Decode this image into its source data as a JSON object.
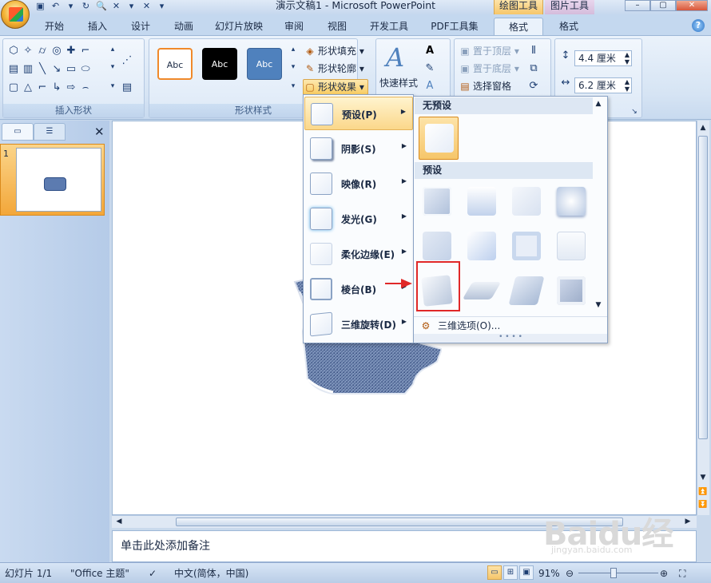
{
  "app": {
    "doc_title": "演示文稿1 - Microsoft PowerPoint",
    "context_tabs": [
      "绘图工具",
      "图片工具"
    ]
  },
  "tabs": [
    "开始",
    "插入",
    "设计",
    "动画",
    "幻灯片放映",
    "审阅",
    "视图",
    "开发工具",
    "PDF工具集",
    "格式",
    "格式"
  ],
  "ribbon": {
    "groups": {
      "insert_shapes": "插入形状",
      "shape_styles": "形状样式"
    },
    "style_swatches": [
      "Abc",
      "Abc",
      "Abc"
    ],
    "shape_fill": "形状填充",
    "shape_outline": "形状轮廓",
    "shape_effects": "形状效果",
    "quick_styles": "快速样式",
    "bring_front": "置于顶层",
    "send_back": "置于底层",
    "selection_pane": "选择窗格",
    "height_value": "4.4 厘米",
    "width_value": "6.2 厘米"
  },
  "effect_menu": {
    "items": [
      "预设(P)",
      "阴影(S)",
      "映像(R)",
      "发光(G)",
      "柔化边缘(E)",
      "棱台(B)",
      "三维旋转(D)"
    ],
    "active_index": 0
  },
  "gallery": {
    "no_preset": "无预设",
    "presets": "预设",
    "options": "三维选项(O)...",
    "selected_row": 2,
    "selected_col": 0
  },
  "slides_panel": {
    "slide_number": "1"
  },
  "notes_placeholder": "单击此处添加备注",
  "status": {
    "slide": "幻灯片 1/1",
    "theme": "\"Office 主题\"",
    "language": "中文(简体，中国)",
    "zoom": "91%"
  },
  "watermark": {
    "main": "Baidu经验",
    "sub": "jingyan.baidu.com"
  },
  "colors": {
    "ribbon_bg": "#dde9f7",
    "accent_orange": "#f6c66a",
    "highlight_red": "#e02828",
    "swatch_orange": "#f0892a",
    "swatch_black": "#000000",
    "swatch_blue": "#4f81bd"
  }
}
